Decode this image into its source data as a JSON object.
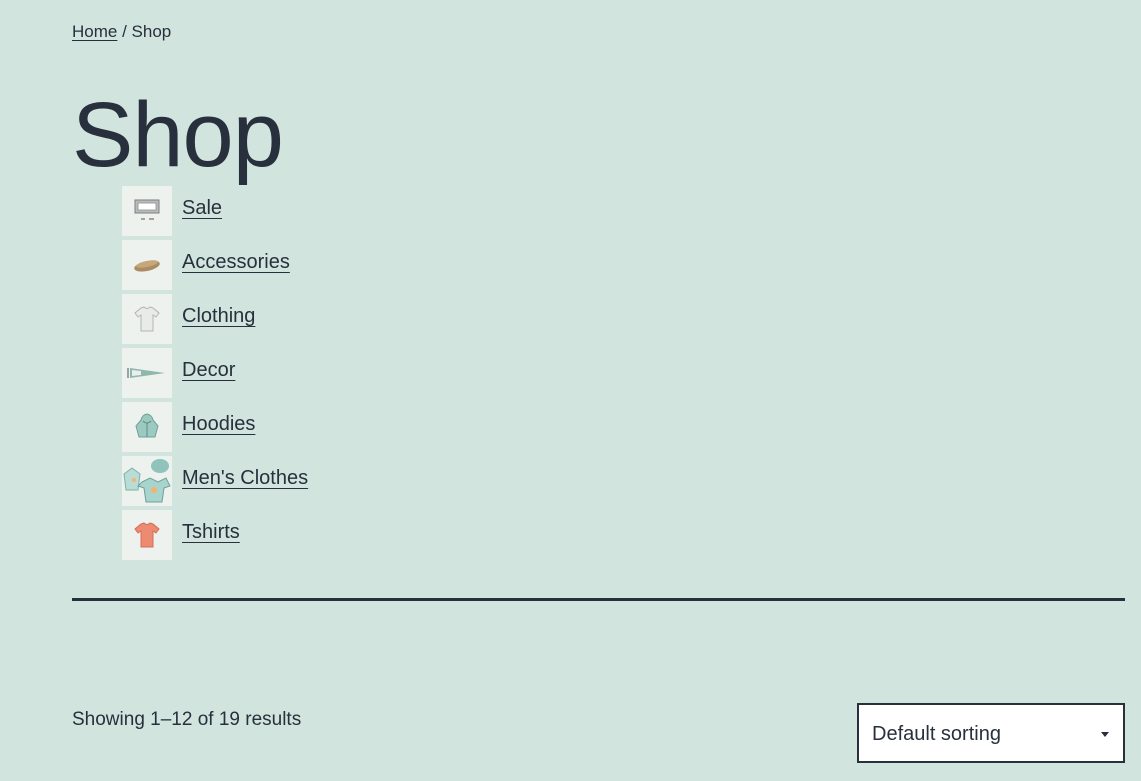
{
  "breadcrumb": {
    "home": "Home",
    "separator": " / ",
    "current": "Shop"
  },
  "page": {
    "title": "Shop"
  },
  "categories": [
    {
      "label": "Sale",
      "icon": "woo-sign-icon"
    },
    {
      "label": "Accessories",
      "icon": "belt-icon"
    },
    {
      "label": "Clothing",
      "icon": "tshirt-icon"
    },
    {
      "label": "Decor",
      "icon": "pennant-icon"
    },
    {
      "label": "Hoodies",
      "icon": "hoodie-icon"
    },
    {
      "label": "Men's Clothes",
      "icon": "clothes-set-icon"
    },
    {
      "label": "Tshirts",
      "icon": "tshirt-icon"
    }
  ],
  "results": {
    "count_text": "Showing 1–12 of 19 results"
  },
  "sorting": {
    "selected": "Default sorting"
  },
  "colors": {
    "background": "#d1e4dd",
    "text": "#28303d"
  }
}
